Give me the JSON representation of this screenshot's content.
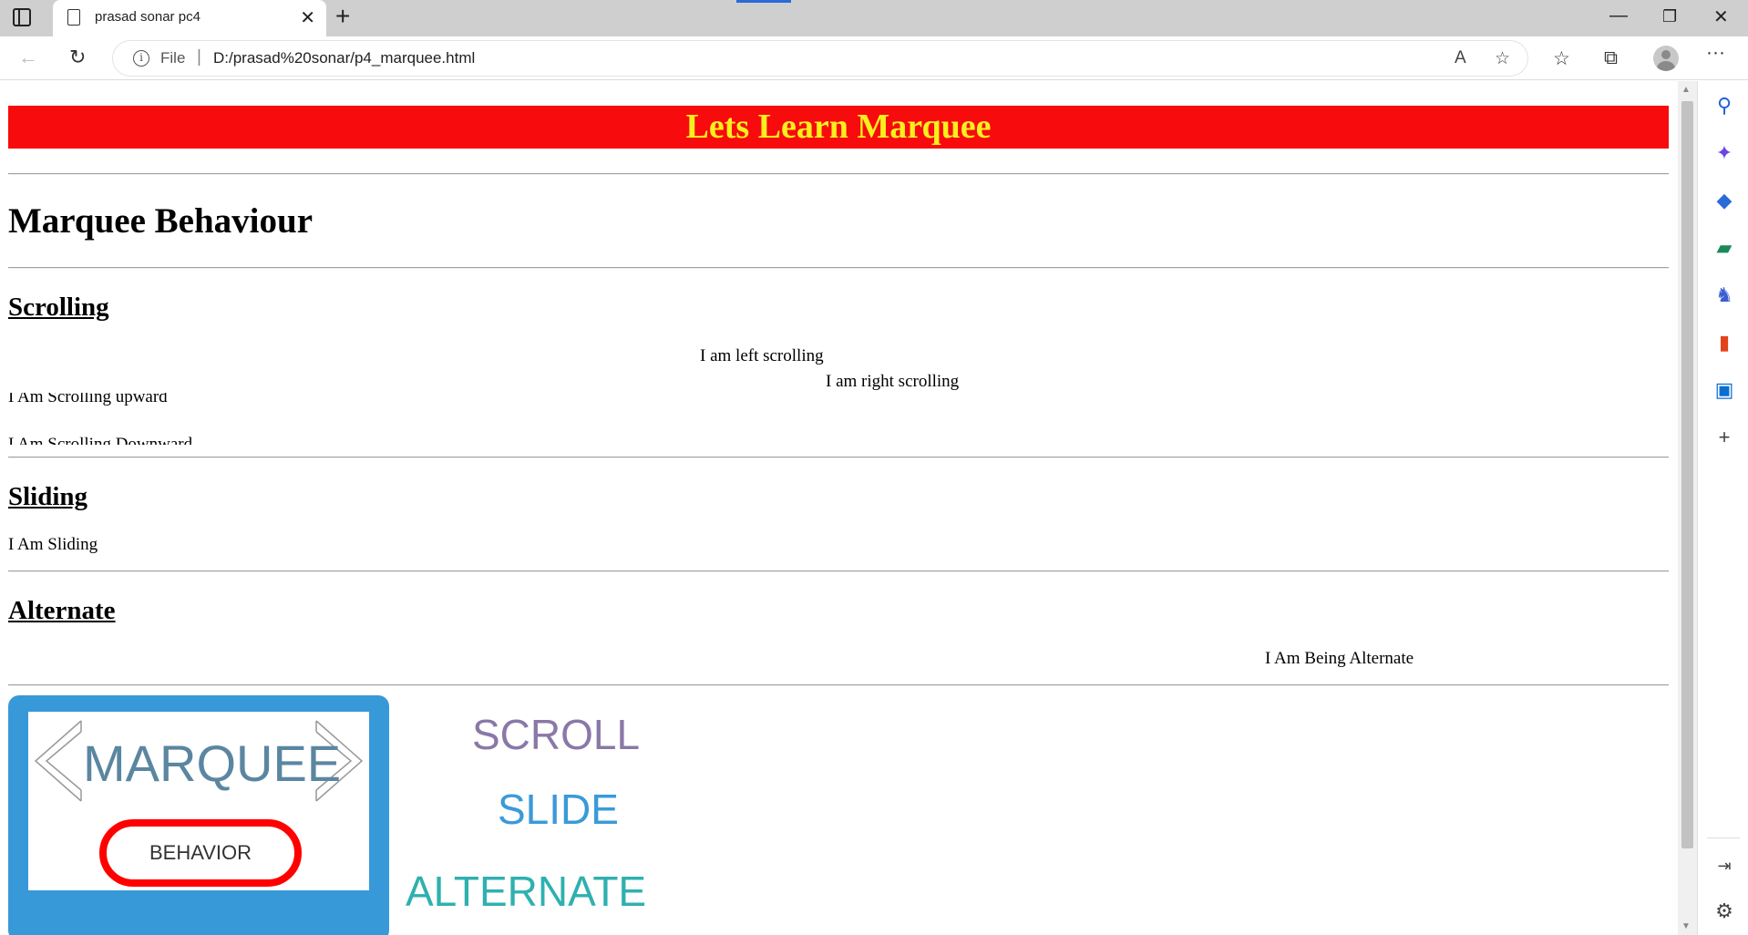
{
  "tab": {
    "title": "prasad sonar pc4"
  },
  "address_bar": {
    "scheme_label": "File",
    "url": "D:/prasad%20sonar/p4_marquee.html"
  },
  "page": {
    "banner": "Lets Learn Marquee",
    "heading": "Marquee Behaviour",
    "scrolling": {
      "heading": "Scrolling",
      "left_text": "I am left scrolling",
      "right_text": "I am right scrolling",
      "up_text": "I Am Scrolling upward",
      "down_text": "I Am Scrolling Downward"
    },
    "sliding": {
      "heading": "Sliding",
      "text": "I Am Sliding"
    },
    "alternate": {
      "heading": "Alternate",
      "text": "I Am Being Alternate"
    },
    "image": {
      "logo_word": "MARQUEE",
      "logo_pill": "BEHAVIOR",
      "words": [
        "SCROLL",
        "SLIDE",
        "ALTERNATE"
      ],
      "colors": {
        "scroll": "#8a78a8",
        "slide": "#3b9ad8",
        "alternate": "#2fb0b0",
        "frame": "#3899d8",
        "pill": "#ff0000"
      }
    }
  },
  "colors": {
    "banner_bg": "#f70b0c",
    "banner_text": "#f7ef1e"
  },
  "icons": [
    "sidebar-toggle-icon",
    "page-icon",
    "close-icon",
    "new-tab-icon",
    "minimize-icon",
    "maximize-icon",
    "close-window-icon",
    "back-icon",
    "reload-icon",
    "info-icon",
    "read-aloud-icon",
    "add-favorite-icon",
    "favorites-icon",
    "collections-icon",
    "profile-icon",
    "more-icon",
    "search-icon",
    "copilot-icon",
    "shopping-icon",
    "tools-icon",
    "games-icon",
    "office-icon",
    "outlook-icon",
    "add-icon",
    "split-screen-icon",
    "settings-icon"
  ]
}
